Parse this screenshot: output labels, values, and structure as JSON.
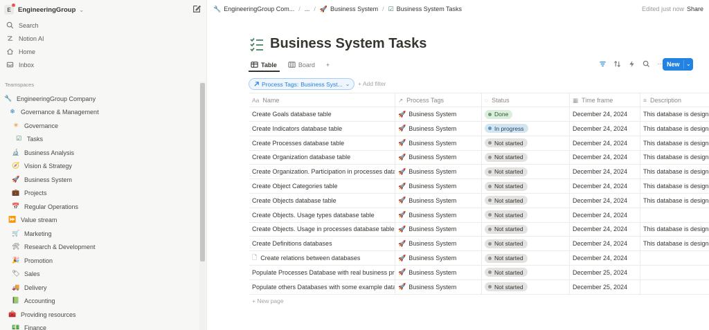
{
  "sidebar": {
    "workspace": {
      "logo_letter": "E",
      "name": "EngineeringGroup"
    },
    "nav": [
      {
        "label": "Search",
        "icon": "search-icon"
      },
      {
        "label": "Notion AI",
        "icon": "ai-icon"
      },
      {
        "label": "Home",
        "icon": "home-icon"
      },
      {
        "label": "Inbox",
        "icon": "inbox-icon"
      }
    ],
    "section_label": "Teamspaces",
    "tree": [
      {
        "label": "EngineeringGroup Company",
        "emoji": "🔧"
      },
      {
        "label": "Governance & Management",
        "emoji": "❄"
      },
      {
        "label": "Governance",
        "emoji": "✳"
      },
      {
        "label": "Tasks",
        "emoji": "☑"
      },
      {
        "label": "Business Analysis",
        "emoji": "🔬"
      },
      {
        "label": "Vision & Strategy",
        "emoji": "🧭"
      },
      {
        "label": "Business System",
        "emoji": "🚀"
      },
      {
        "label": "Projects",
        "emoji": "💼"
      },
      {
        "label": "Regular Operations",
        "emoji": "📅"
      },
      {
        "label": "Value stream",
        "emoji": "⏩"
      },
      {
        "label": "Marketing",
        "emoji": "🛒"
      },
      {
        "label": "Research & Development",
        "emoji": "🛠"
      },
      {
        "label": "Promotion",
        "emoji": "🎉"
      },
      {
        "label": "Sales",
        "emoji": "🏷"
      },
      {
        "label": "Delivery",
        "emoji": "🚚"
      },
      {
        "label": "Accounting",
        "emoji": "📗"
      },
      {
        "label": "Providing resources",
        "emoji": "🧰"
      },
      {
        "label": "Finance",
        "emoji": "💵"
      }
    ]
  },
  "topbar": {
    "breadcrumbs": [
      {
        "label": "EngineeringGroup Com...",
        "emoji": "🔧"
      },
      {
        "label": "...",
        "emoji": ""
      },
      {
        "label": "Business System",
        "emoji": "🚀"
      },
      {
        "label": "Business System Tasks",
        "emoji": "☑"
      }
    ],
    "edited": "Edited just now",
    "share": "Share"
  },
  "page": {
    "title": "Business System Tasks"
  },
  "views": {
    "tabs": [
      {
        "label": "Table"
      },
      {
        "label": "Board"
      }
    ],
    "add": "+",
    "more": "···",
    "new_label": "New"
  },
  "filter": {
    "prop": "Process Tags:",
    "value": "Business Syst...",
    "add_filter": "+ Add filter"
  },
  "table": {
    "columns": [
      {
        "label": "Name",
        "icon": "Aa"
      },
      {
        "label": "Process Tags",
        "icon": "↗"
      },
      {
        "label": "Status",
        "icon": "◌"
      },
      {
        "label": "Time frame",
        "icon": "▦"
      },
      {
        "label": "Description",
        "icon": "≡"
      }
    ],
    "rows": [
      {
        "name": "Create Goals database table",
        "tag": "Business System",
        "status": "Done",
        "status_kind": "done",
        "time": "December 24, 2024",
        "desc": "This database is designed"
      },
      {
        "name": "Create Indicators database table",
        "tag": "Business System",
        "status": "In progress",
        "status_kind": "prog",
        "time": "December 24, 2024",
        "desc": "This database is designed"
      },
      {
        "name": "Create Processes database table",
        "tag": "Business System",
        "status": "Not started",
        "status_kind": "not",
        "time": "December 24, 2024",
        "desc": "This database is designed"
      },
      {
        "name": "Create Organization database table",
        "tag": "Business System",
        "status": "Not started",
        "status_kind": "not",
        "time": "December 24, 2024",
        "desc": "This database is designed"
      },
      {
        "name": "Create Organization. Participation in processes data",
        "tag": "Business System",
        "status": "Not started",
        "status_kind": "not",
        "time": "December 24, 2024",
        "desc": "This database is designed"
      },
      {
        "name": "Create Object Categories table",
        "tag": "Business System",
        "status": "Not started",
        "status_kind": "not",
        "time": "December 24, 2024",
        "desc": "This database is designed"
      },
      {
        "name": "Create Objects database table",
        "tag": "Business System",
        "status": "Not started",
        "status_kind": "not",
        "time": "December 24, 2024",
        "desc": "This database is designed"
      },
      {
        "name": "Create Objects. Usage types database table",
        "tag": "Business System",
        "status": "Not started",
        "status_kind": "not",
        "time": "December 24, 2024",
        "desc": ""
      },
      {
        "name": "Create Objects. Usage in processes database table",
        "tag": "Business System",
        "status": "Not started",
        "status_kind": "not",
        "time": "December 24, 2024",
        "desc": "This database is designed"
      },
      {
        "name": "Create Definitions databases",
        "tag": "Business System",
        "status": "Not started",
        "status_kind": "not",
        "time": "December 24, 2024",
        "desc": "This database is designed"
      },
      {
        "name": "Create relations between databases",
        "tag": "Business System",
        "status": "Not started",
        "status_kind": "not",
        "time": "December 24, 2024",
        "desc": "",
        "doc_icon": true
      },
      {
        "name": "Populate Processes Database with real business pro",
        "tag": "Business System",
        "status": "Not started",
        "status_kind": "not",
        "time": "December 25, 2024",
        "desc": ""
      },
      {
        "name": "Populate others Databases with some example data",
        "tag": "Business System",
        "status": "Not started",
        "status_kind": "not",
        "time": "December 25, 2024",
        "desc": ""
      }
    ],
    "tag_emoji": "🚀",
    "new_page": "+ New page"
  }
}
